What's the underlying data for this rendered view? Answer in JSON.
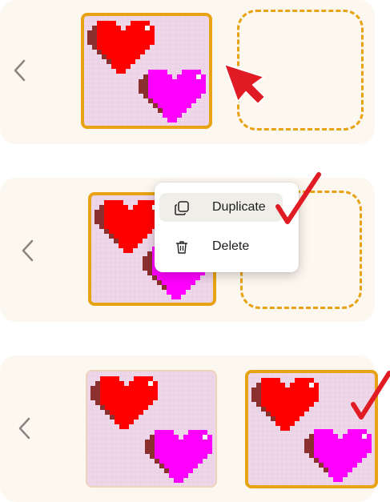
{
  "colors": {
    "panel": "#fcf7ef",
    "selection_border": "#e7a313",
    "slot_dashed": "#e7a313",
    "canvas": "#efd7ea",
    "heart_red": "#ff0000",
    "heart_red_shadow": "#8b2f2f",
    "heart_magenta": "#ff00ff",
    "heart_magenta_shadow": "#8b2f2f",
    "checkmark": "#e01b24",
    "cursor": "#e01b24"
  },
  "icons": {
    "back": "chevron-left-icon",
    "duplicate": "copy-icon",
    "delete": "trash-icon"
  },
  "context_menu": {
    "items": [
      {
        "label": "Duplicate",
        "icon": "copy-icon",
        "hovered": true
      },
      {
        "label": "Delete",
        "icon": "trash-icon",
        "hovered": false
      }
    ]
  }
}
